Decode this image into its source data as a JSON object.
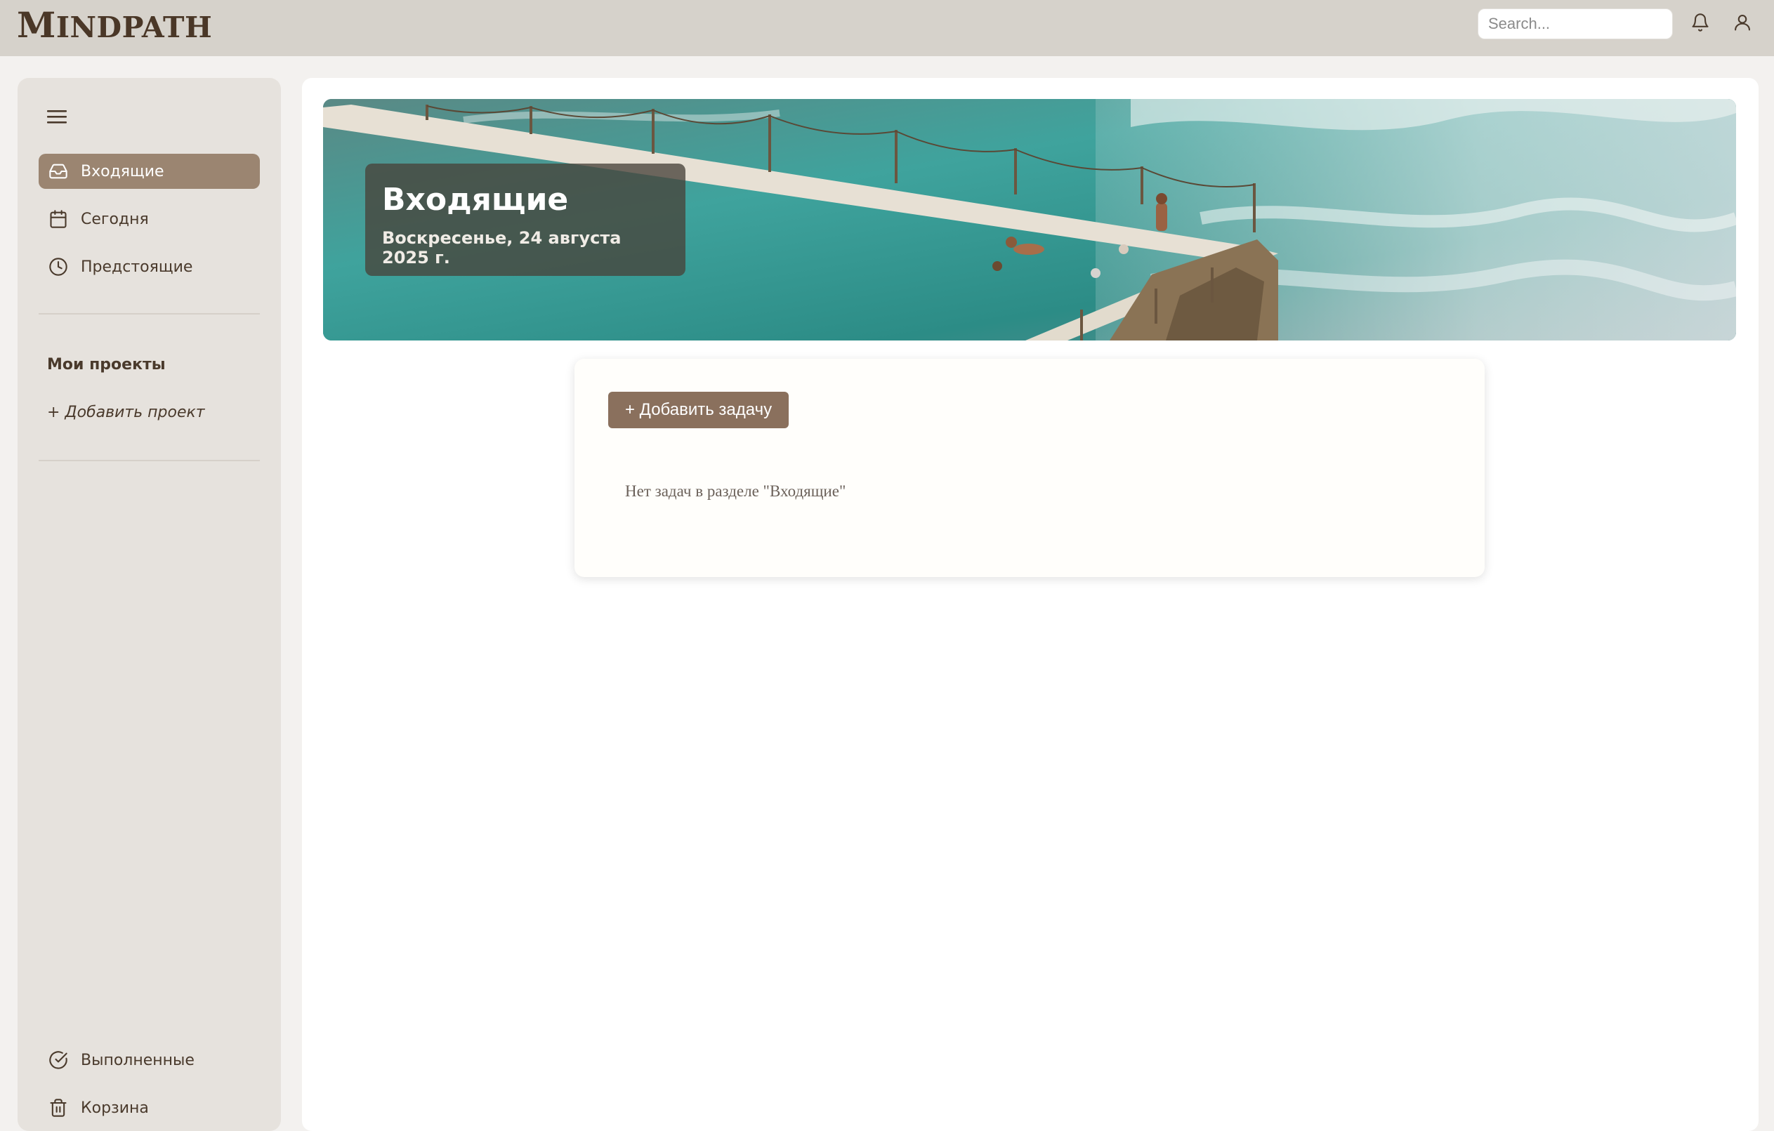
{
  "app": {
    "logo": "Mindpath"
  },
  "header": {
    "search_placeholder": "Search...",
    "icons": [
      "bell-icon",
      "user-icon"
    ]
  },
  "sidebar": {
    "menu_icon": "hamburger-menu-icon",
    "items": [
      {
        "label": "Входящие",
        "icon": "inbox-icon",
        "active": true
      },
      {
        "label": "Сегодня",
        "icon": "calendar-icon",
        "active": false
      },
      {
        "label": "Предстоящие",
        "icon": "clock-icon",
        "active": false
      }
    ],
    "projects_title": "Мои проекты",
    "add_project": "+ Добавить проект",
    "bottom_items": [
      {
        "label": "Выполненные",
        "icon": "check-circle-icon"
      },
      {
        "label": "Корзина",
        "icon": "trash-icon"
      }
    ]
  },
  "main": {
    "hero": {
      "title": "Входящие",
      "date": "Воскресенье, 24 августа 2025 г."
    },
    "add_task_label": "+ Добавить задачу",
    "empty_message": "Нет задач в разделе \"Входящие\""
  },
  "colors": {
    "topbar": "#d6d2cb",
    "sidebar": "#e6e2dd",
    "accent": "#9b8571",
    "button": "#8a705d",
    "text": "#4a3a2c"
  }
}
